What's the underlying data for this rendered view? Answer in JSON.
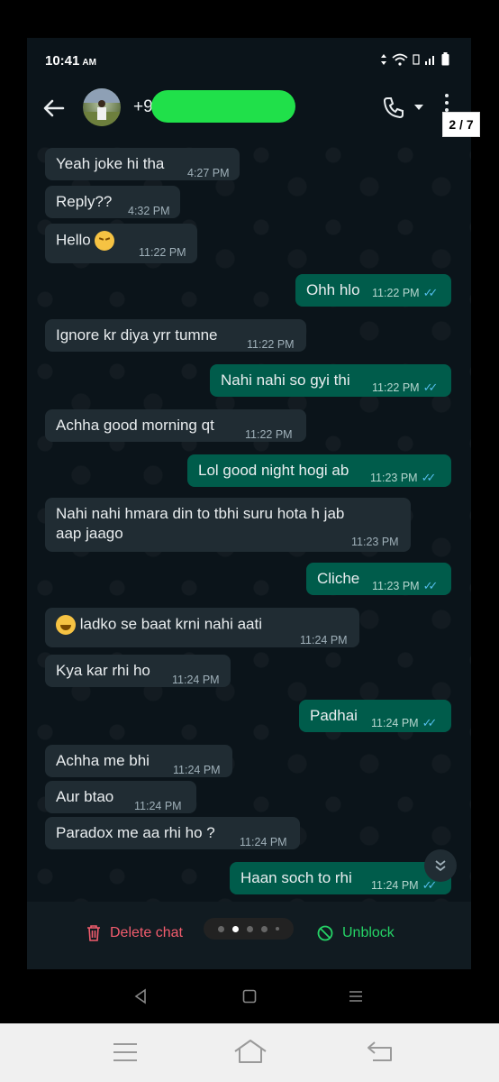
{
  "status_bar": {
    "time": "10:41",
    "ampm": "AM"
  },
  "header": {
    "contact": "+9",
    "page_counter": "2 / 7"
  },
  "messages": [
    {
      "text": "Yeah joke hi tha",
      "time": "4:27 PM"
    },
    {
      "text": "Reply??",
      "time": "4:32 PM"
    },
    {
      "text": "Hello",
      "time": "11:22 PM"
    },
    {
      "text": "Ohh hlo",
      "time": "11:22 PM"
    },
    {
      "text": "Ignore kr diya yrr tumne",
      "time": "11:22 PM"
    },
    {
      "text": "Nahi nahi so gyi thi",
      "time": "11:22 PM"
    },
    {
      "text": "Achha good morning qt",
      "time": "11:22 PM"
    },
    {
      "text": "Lol good night hogi ab",
      "time": "11:23 PM"
    },
    {
      "text": "Nahi nahi hmara din to tbhi suru hota h jab",
      "text2": "aap jaago",
      "time": "11:23 PM"
    },
    {
      "text": "Cliche",
      "time": "11:23 PM"
    },
    {
      "text": "ladko se baat krni nahi aati",
      "time": "11:24 PM"
    },
    {
      "text": "Kya kar rhi ho",
      "time": "11:24 PM"
    },
    {
      "text": "Padhai",
      "time": "11:24 PM"
    },
    {
      "text": "Achha me bhi",
      "time": "11:24 PM"
    },
    {
      "text": "Aur btao",
      "time": "11:24 PM"
    },
    {
      "text": "Paradox me aa rhi ho ?",
      "time": "11:24 PM"
    },
    {
      "text": "Haan soch to rhi",
      "time": "11:24 PM"
    }
  ],
  "bottom": {
    "delete_label": "Delete chat",
    "unblock_label": "Unblock"
  },
  "colors": {
    "incoming": "#202c33",
    "outgoing": "#005c4b",
    "background": "#0b141a",
    "read_tick": "#53bdeb",
    "delete": "#f15c6d",
    "unblock": "#25d366"
  }
}
